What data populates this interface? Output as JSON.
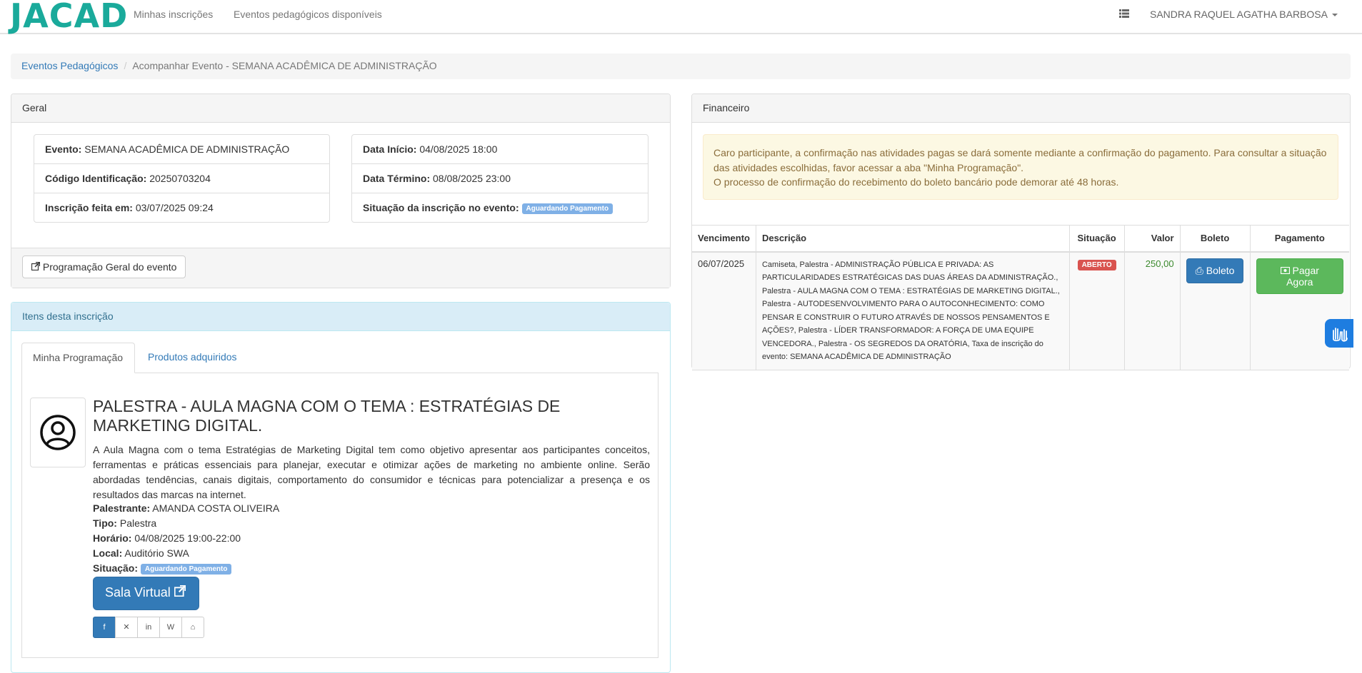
{
  "navbar": {
    "logo": "JACAD",
    "links": [
      "Minhas inscrições",
      "Eventos pedagógicos disponíveis"
    ],
    "user": "SANDRA RAQUEL AGATHA BARBOSA"
  },
  "breadcrumb": {
    "link": "Eventos Pedagógicos",
    "active": "Acompanhar Evento - SEMANA ACADÊMICA DE ADMINISTRAÇÃO"
  },
  "geral": {
    "heading": "Geral",
    "left": [
      {
        "label": "Evento:",
        "value": "SEMANA ACADÊMICA DE ADMINISTRAÇÃO"
      },
      {
        "label": "Código Identificação:",
        "value": "20250703204"
      },
      {
        "label": "Inscrição feita em:",
        "value": "03/07/2025 09:24"
      }
    ],
    "right": [
      {
        "label": "Data Início:",
        "value": "04/08/2025 18:00"
      },
      {
        "label": "Data Término:",
        "value": "08/08/2025 23:00"
      },
      {
        "label": "Situação da inscrição no evento:",
        "value": "Aguardando Pagamento"
      }
    ],
    "button": "Programação Geral do evento"
  },
  "itens": {
    "heading": "Itens desta inscrição",
    "tabs": [
      "Minha Programação",
      "Produtos adquiridos"
    ],
    "activity": {
      "title": "PALESTRA - AULA MAGNA COM O TEMA : ESTRATÉGIAS DE MARKETING DIGITAL.",
      "description": "A Aula Magna com o tema Estratégias de Marketing Digital tem como objetivo apresentar aos participantes conceitos, ferramentas e práticas essenciais para planejar, executar e otimizar ações de marketing no ambiente online. Serão abordadas tendências, canais digitais, comportamento do consumidor e técnicas para potencializar a presença e os resultados das marcas na internet.",
      "palestrante_label": "Palestrante:",
      "palestrante": "AMANDA COSTA OLIVEIRA",
      "tipo_label": "Tipo:",
      "tipo": "Palestra",
      "horario_label": "Horário:",
      "horario": "04/08/2025 19:00-22:00",
      "local_label": "Local:",
      "local": "Auditório SWA",
      "situacao_label": "Situação:",
      "situacao": "Aguardando Pagamento",
      "button": "Sala Virtual"
    },
    "social_icons": [
      "facebook-icon",
      "x-icon",
      "linkedin-icon",
      "wordpress-icon",
      "institution-icon"
    ]
  },
  "financeiro": {
    "heading": "Financeiro",
    "alert_line1": "Caro participante, a confirmação nas atividades pagas se dará somente mediante a confirmação do pagamento. Para consultar a situação das atividades escolhidas, favor acessar a aba \"Minha Programação\".",
    "alert_line2": "O processo de confirmação do recebimento do boleto bancário pode demorar até 48 horas.",
    "columns": [
      "Vencimento",
      "Descrição",
      "Situação",
      "Valor",
      "Boleto",
      "Pagamento"
    ],
    "row": {
      "vencimento": "06/07/2025",
      "descricao": "Camiseta, Palestra - ADMINISTRAÇÃO PÚBLICA E PRIVADA: AS PARTICULARIDADES ESTRATÉGICAS DAS DUAS ÁREAS DA ADMINISTRAÇÃO., Palestra - AULA MAGNA COM O TEMA : ESTRATÉGIAS DE MARKETING DIGITAL., Palestra - AUTODESENVOLVIMENTO PARA O AUTOCONHECIMENTO: COMO PENSAR E CONSTRUIR O FUTURO ATRAVÉS DE NOSSOS PENSAMENTOS E AÇÕES?, Palestra - LÍDER TRANSFORMADOR: A FORÇA DE UMA EQUIPE VENCEDORA., Palestra - OS SEGREDOS DA ORATÓRIA, Taxa de inscrição do evento: SEMANA ACADÊMICA DE ADMINISTRAÇÃO",
      "situacao": "ABERTO",
      "valor": "250,00",
      "boleto": "Boleto",
      "pagamento": "Pagar Agora"
    }
  }
}
